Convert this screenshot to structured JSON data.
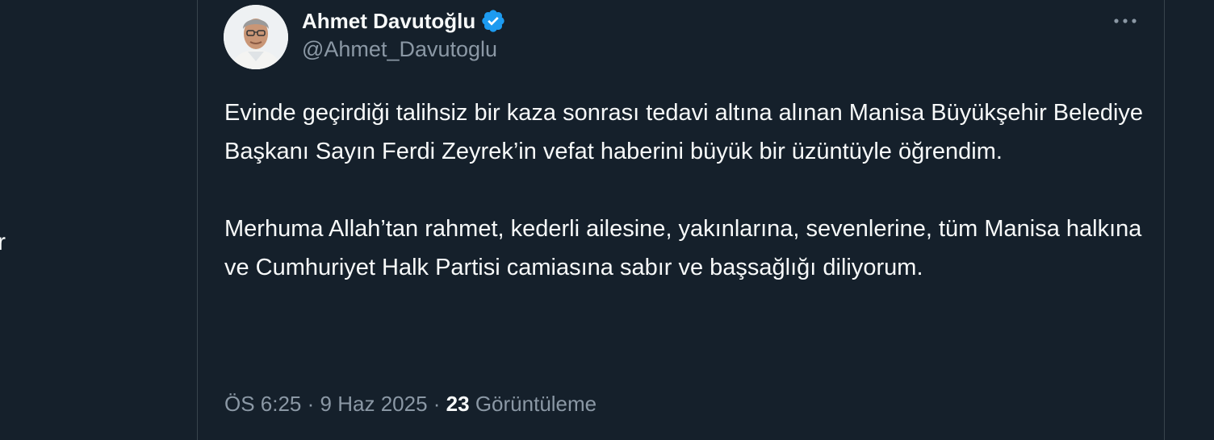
{
  "left_panel": {
    "fragment_text": "r"
  },
  "tweet": {
    "author": {
      "display_name": "Ahmet Davutoğlu",
      "handle": "@Ahmet_Davutoglu",
      "verified": true,
      "verified_color": "#1d9bf0"
    },
    "more_icon": "more-horizontal-icon",
    "paragraphs": [
      "Evinde geçirdiği talihsiz bir kaza sonrası tedavi altına alınan Manisa Büyükşehir Belediye Başkanı Sayın Ferdi Zeyrek’in vefat haberini büyük bir üzüntüyle öğrendim.",
      "Merhuma Allah’tan rahmet, kederli ailesine, yakınlarına, sevenlerine, tüm Manisa halkına ve Cumhuriyet Halk Partisi camiasına sabır ve başsağlığı diliyorum."
    ],
    "time": "ÖS 6:25",
    "separator": "·",
    "date": "9 Haz 2025",
    "views_count": "23",
    "views_label": "Görüntüleme"
  },
  "colors": {
    "background": "#15202b",
    "border": "#38444d",
    "text_primary": "#f7f9f9",
    "text_secondary": "#8b98a5"
  }
}
